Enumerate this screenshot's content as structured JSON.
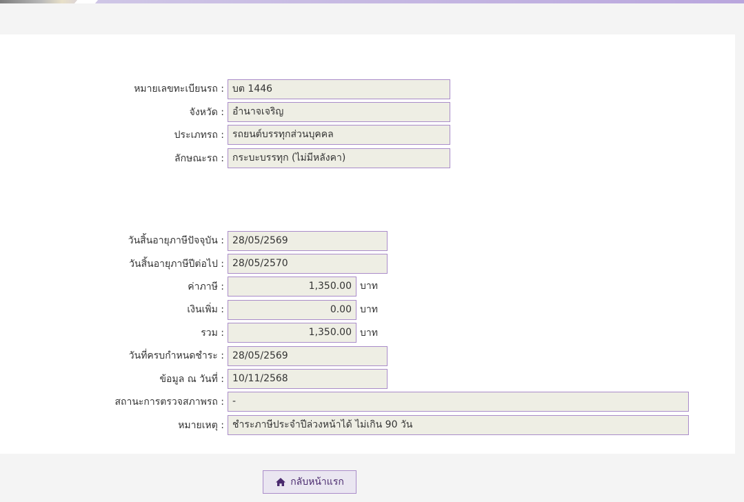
{
  "vehicle": {
    "plate_label": "หมายเลขทะเบียนรถ :",
    "plate_value": "บต 1446",
    "province_label": "จังหวัด :",
    "province_value": "อำนาจเจริญ",
    "type_label": "ประเภทรถ :",
    "type_value": "รถยนต์บรรทุกส่วนบุคคล",
    "style_label": "ลักษณะรถ :",
    "style_value": "กระบะบรรทุก (ไม่มีหลังคา)"
  },
  "tax": {
    "current_expiry_label": "วันสิ้นอายุภาษีปัจจุบัน :",
    "current_expiry_value": "28/05/2569",
    "next_expiry_label": "วันสิ้นอายุภาษีปีต่อไป :",
    "next_expiry_value": "28/05/2570",
    "tax_amount_label": "ค่าภาษี :",
    "tax_amount_value": "1,350.00",
    "surcharge_label": "เงินเพิ่ม :",
    "surcharge_value": "0.00",
    "total_label": "รวม :",
    "total_value": "1,350.00",
    "currency_unit": "บาท",
    "due_date_label": "วันที่ครบกำหนดชำระ :",
    "due_date_value": "28/05/2569",
    "data_as_of_label": "ข้อมูล ณ วันที่ :",
    "data_as_of_value": "10/11/2568",
    "inspection_status_label": "สถานะการตรวจสภาพรถ :",
    "inspection_status_value": "-",
    "remark_label": "หมายเหตุ :",
    "remark_value": "ชำระภาษีประจำปีล่วงหน้าได้ ไม่เกิน 90 วัน"
  },
  "actions": {
    "home_label": "กลับหน้าแรก",
    "home_icon": "home-icon"
  },
  "colors": {
    "field_border": "#a98bc9",
    "field_bg": "#eeeee4",
    "accent": "#4a2a6e"
  }
}
